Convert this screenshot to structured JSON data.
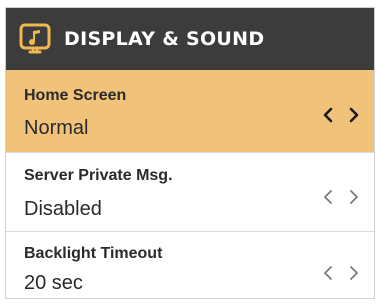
{
  "header": {
    "title": "DISPLAY & SOUND",
    "icon": "music-note-display-icon"
  },
  "colors": {
    "header_bg": "#3c3c3c",
    "selected_bg": "#f1c37a",
    "text": "#2a2a2a",
    "arrow_active": "#1a1a1a",
    "arrow_inactive": "#7a7a7a"
  },
  "settings": [
    {
      "label": "Home Screen",
      "value": "Normal",
      "selected": true,
      "prev_icon": "chevron-left-icon",
      "next_icon": "chevron-right-icon"
    },
    {
      "label": "Server Private Msg.",
      "value": "Disabled",
      "selected": false,
      "prev_icon": "chevron-left-icon",
      "next_icon": "chevron-right-icon"
    },
    {
      "label": "Backlight Timeout",
      "value": "20 sec",
      "selected": false,
      "prev_icon": "chevron-left-icon",
      "next_icon": "chevron-right-icon"
    }
  ]
}
